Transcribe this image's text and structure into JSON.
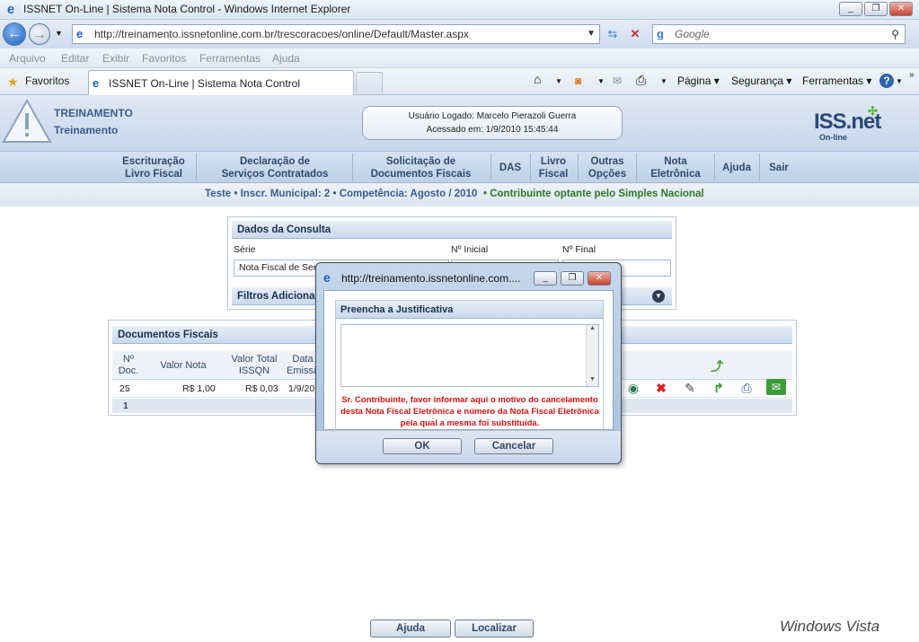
{
  "browser": {
    "window_title": "ISSNET On-Line | Sistema Nota Control - Windows Internet Explorer",
    "url": "http://treinamento.issnetonline.com.br/trescoracoes/online/Default/Master.aspx",
    "search_placeholder": "Google",
    "menu": [
      "Arquivo",
      "Editar",
      "Exibir",
      "Favoritos",
      "Ferramentas",
      "Ajuda"
    ],
    "favorites_label": "Favoritos",
    "tab_title": "ISSNET On-Line | Sistema Nota Control",
    "commands": {
      "pagina": "Página",
      "seguranca": "Segurança",
      "ferramentas": "Ferramentas"
    }
  },
  "header": {
    "org_name": "TREINAMENTO",
    "org_sub": "Treinamento",
    "user_line": "Usuário Logado: Marcelo Pierazoli Guerra",
    "access_line": "Acessado em: 1/9/2010 15:45:44",
    "logo_text": "ISS.net",
    "logo_sub": "On-line"
  },
  "nav": [
    {
      "l1": "Escrituração",
      "l2": "Livro Fiscal"
    },
    {
      "l1": "Declaração de",
      "l2": "Serviços Contratados"
    },
    {
      "l1": "Solicitação de",
      "l2": "Documentos Fiscais"
    },
    {
      "l1": "DAS",
      "l2": ""
    },
    {
      "l1": "Livro",
      "l2": "Fiscal"
    },
    {
      "l1": "Outras",
      "l2": "Opções"
    },
    {
      "l1": "Nota",
      "l2": "Eletrônica"
    },
    {
      "l1": "Ajuda",
      "l2": ""
    },
    {
      "l1": "Sair",
      "l2": ""
    }
  ],
  "info": {
    "context": "Teste • Inscr. Municipal: 2 • Competência: Agosto / 2010",
    "simples": "• Contribuinte optante pelo Simples Nacional"
  },
  "dados": {
    "title": "Dados da Consulta",
    "serie_label": "Série",
    "inicial_label": "Nº Inicial",
    "final_label": "Nº Final",
    "serie_value": "Nota Fiscal de Ser",
    "filtros_label": "Filtros Adiciona"
  },
  "docs": {
    "title": "Documentos Fiscais",
    "col_ndoc": "Nº Doc.",
    "col_valor": "Valor Nota",
    "col_issqn": "Valor Total ISSQN",
    "col_data": "Data Emissã",
    "row": {
      "ndoc": "25",
      "valor": "R$ 1,00",
      "issqn": "R$ 0,03",
      "data": "1/9/20"
    },
    "page": "1"
  },
  "footer": {
    "ajuda": "Ajuda",
    "localizar": "Localizar",
    "vista": "Windows Vista"
  },
  "modal": {
    "title": "http://treinamento.issnetonline.com....",
    "panel_title": "Preencha a Justificativa",
    "message": "Sr. Contribuinte, favor informar aqui o motivo do cancelamento desta Nota Fiscal Eletrônica e número da Nota Fiscal Eletrônica pela qual a mesma foi substituída.",
    "ok": "OK",
    "cancel": "Cancelar"
  },
  "colors": {
    "accent": "#3a5d8f",
    "success": "#2d7a26",
    "error": "#d11111"
  }
}
